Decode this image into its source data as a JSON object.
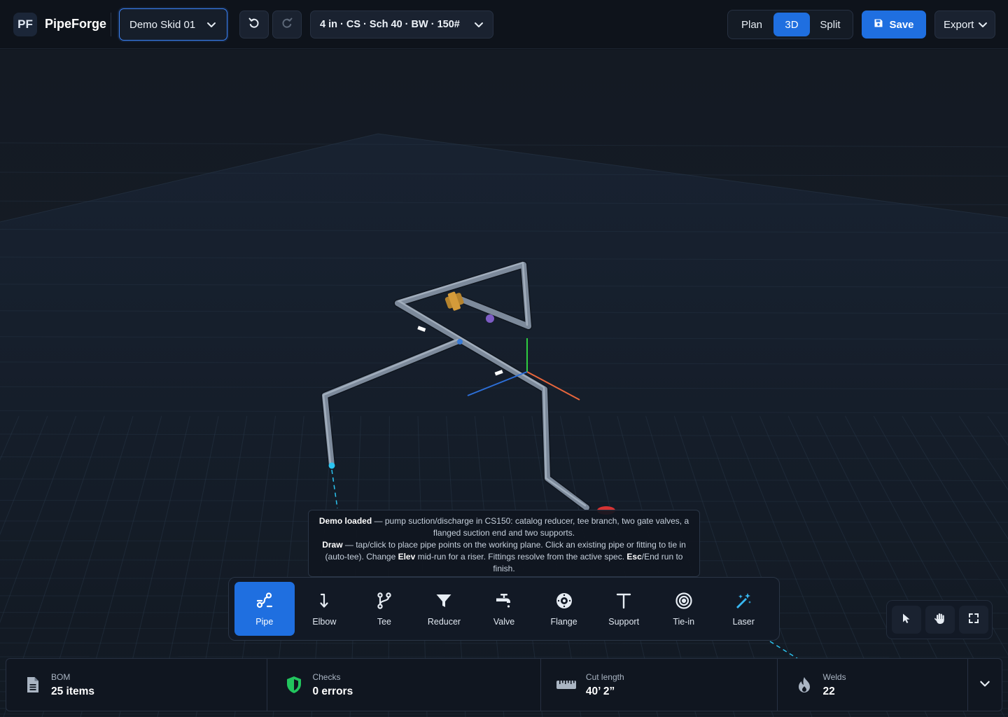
{
  "app": {
    "logo_badge": "PF",
    "name": "PipeForge"
  },
  "toolbar": {
    "project": "Demo Skid 01",
    "undo_icon": "undo-icon",
    "redo_icon": "redo-icon",
    "spec": "4 in · CS · Sch 40 · BW · 150#",
    "views": [
      {
        "label": "Plan",
        "active": false
      },
      {
        "label": "3D",
        "active": true
      },
      {
        "label": "Split",
        "active": false
      }
    ],
    "save_label": "Save",
    "export_label": "Export"
  },
  "hint": {
    "line1_bold": "Demo loaded",
    "line1_rest": " — pump suction/discharge in CS150: catalog reducer, tee branch, two gate valves, a flanged suction end and two supports.",
    "line2_bold": "Draw",
    "line2_a": " — tap/click to place pipe points on the working plane. Click an existing pipe or fitting to tie in (auto-tee). Change ",
    "line2_elev": "Elev",
    "line2_b": " mid-run for a riser. Fittings resolve from the active spec. ",
    "line2_esc": "Esc",
    "line2_c": "/End run to finish."
  },
  "tools": [
    {
      "label": "Pipe",
      "icon": "pipe-icon",
      "active": true
    },
    {
      "label": "Elbow",
      "icon": "elbow-icon",
      "active": false
    },
    {
      "label": "Tee",
      "icon": "tee-icon",
      "active": false
    },
    {
      "label": "Reducer",
      "icon": "reducer-icon",
      "active": false
    },
    {
      "label": "Valve",
      "icon": "valve-icon",
      "active": false
    },
    {
      "label": "Flange",
      "icon": "flange-icon",
      "active": false
    },
    {
      "label": "Support",
      "icon": "support-icon",
      "active": false
    },
    {
      "label": "Tie-in",
      "icon": "tie-in-icon",
      "active": false
    },
    {
      "label": "Laser",
      "icon": "laser-icon",
      "active": false
    }
  ],
  "view_controls": [
    "select-cursor-icon",
    "pan-hand-icon",
    "fullscreen-icon"
  ],
  "status": {
    "bom": {
      "label": "BOM",
      "value": "25 items",
      "icon": "document-icon"
    },
    "checks": {
      "label": "Checks",
      "value": "0 errors",
      "icon": "shield-check-icon",
      "color": "#22c55e"
    },
    "cut_length": {
      "label": "Cut length",
      "value": "40’ 2”",
      "icon": "ruler-icon"
    },
    "welds": {
      "label": "Welds",
      "value": "22",
      "icon": "flame-icon"
    }
  },
  "colors": {
    "accent": "#1f6fe0",
    "background": "#151b25",
    "grid": "#2a3a4c",
    "pipe": "#8a97a8",
    "valve": "#c08a2c",
    "axis_x": "#e8663c",
    "axis_y": "#2ecc40",
    "axis_z": "#2d6fd8",
    "tie_in_marker": "#2bc4f0",
    "flange_marker": "#e03a3a"
  }
}
